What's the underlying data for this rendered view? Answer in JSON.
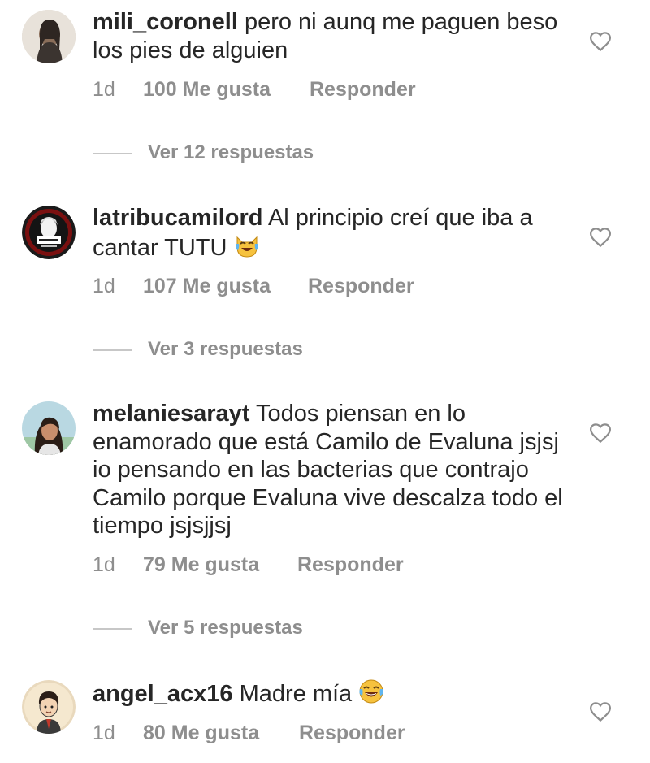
{
  "comments": [
    {
      "username": "mili_coronell",
      "text": "pero ni aunq me paguen beso los pies de alguien",
      "age": "1d",
      "likes": "100 Me gusta",
      "reply": "Responder",
      "view_replies": "Ver 12 respuestas",
      "avatar_icon": "woman-photo-avatar"
    },
    {
      "username": "latribucamilord",
      "text": "Al principio creí que iba a cantar TUTU",
      "emoji": "crying-laughing-cat-emoji",
      "age": "1d",
      "likes": "107 Me gusta",
      "reply": "Responder",
      "view_replies": "Ver 3 respuestas",
      "avatar_icon": "tribu-logo-avatar"
    },
    {
      "username": "melaniesarayt",
      "text": "Todos piensan en lo enamorado que está Camilo de Evaluna jsjsj  io pensando en las bacterias que contrajo Camilo porque Evaluna vive descalza todo el tiempo jsjsjjsj",
      "age": "1d",
      "likes": "79 Me gusta",
      "reply": "Responder",
      "view_replies": "Ver 5 respuestas",
      "avatar_icon": "girl-photo-avatar"
    },
    {
      "username": "angel_acx16",
      "text": "Madre mía",
      "emoji": "tears-of-joy-emoji",
      "age": "1d",
      "likes": "80 Me gusta",
      "reply": "Responder",
      "avatar_icon": "cartoon-boy-avatar"
    }
  ],
  "colors": {
    "text": "#262626",
    "meta": "#8e8e8e",
    "divider": "#c7c7c7",
    "heart_stroke": "#8e8e8e"
  }
}
